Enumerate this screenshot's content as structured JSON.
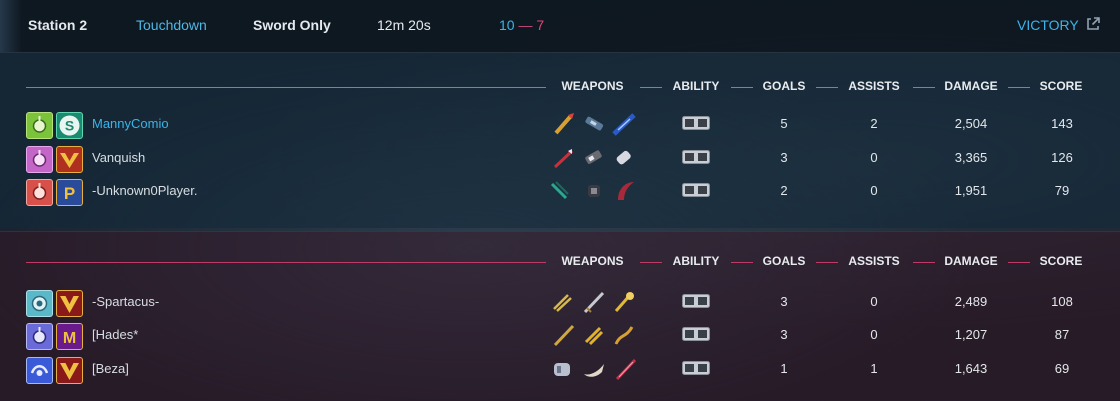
{
  "header": {
    "station": "Station 2",
    "mode": "Touchdown",
    "variant": "Sword Only",
    "duration": "12m 20s",
    "score_blue": "10",
    "score_sep": "—",
    "score_red": "7",
    "result": "VICTORY",
    "external_link_icon": "external-link-icon"
  },
  "columns": {
    "weapons": "WEAPONS",
    "ability": "ABILITY",
    "goals": "GOALS",
    "assists": "ASSISTS",
    "damage": "DAMAGE",
    "score": "SCORE"
  },
  "colors": {
    "blue_accent": "#3ab4ea",
    "red_accent": "#e0467a",
    "header_bg": "#0c141c"
  },
  "teams": [
    {
      "side": "blue",
      "players": [
        {
          "name": "MannyComio",
          "goals": "5",
          "assists": "2",
          "damage": "2,504",
          "score": "143",
          "self": true
        },
        {
          "name": "Vanquish",
          "goals": "3",
          "assists": "0",
          "damage": "3,365",
          "score": "126"
        },
        {
          "name": "-Unknown0Player.",
          "goals": "2",
          "assists": "0",
          "damage": "1,951",
          "score": "79"
        }
      ]
    },
    {
      "side": "red",
      "players": [
        {
          "name": "-Spartacus-",
          "goals": "3",
          "assists": "0",
          "damage": "2,489",
          "score": "108"
        },
        {
          "name": "[Hades*",
          "goals": "3",
          "assists": "0",
          "damage": "1,207",
          "score": "87"
        },
        {
          "name": "[Beza]",
          "goals": "1",
          "assists": "1",
          "damage": "1,643",
          "score": "69"
        }
      ]
    }
  ]
}
